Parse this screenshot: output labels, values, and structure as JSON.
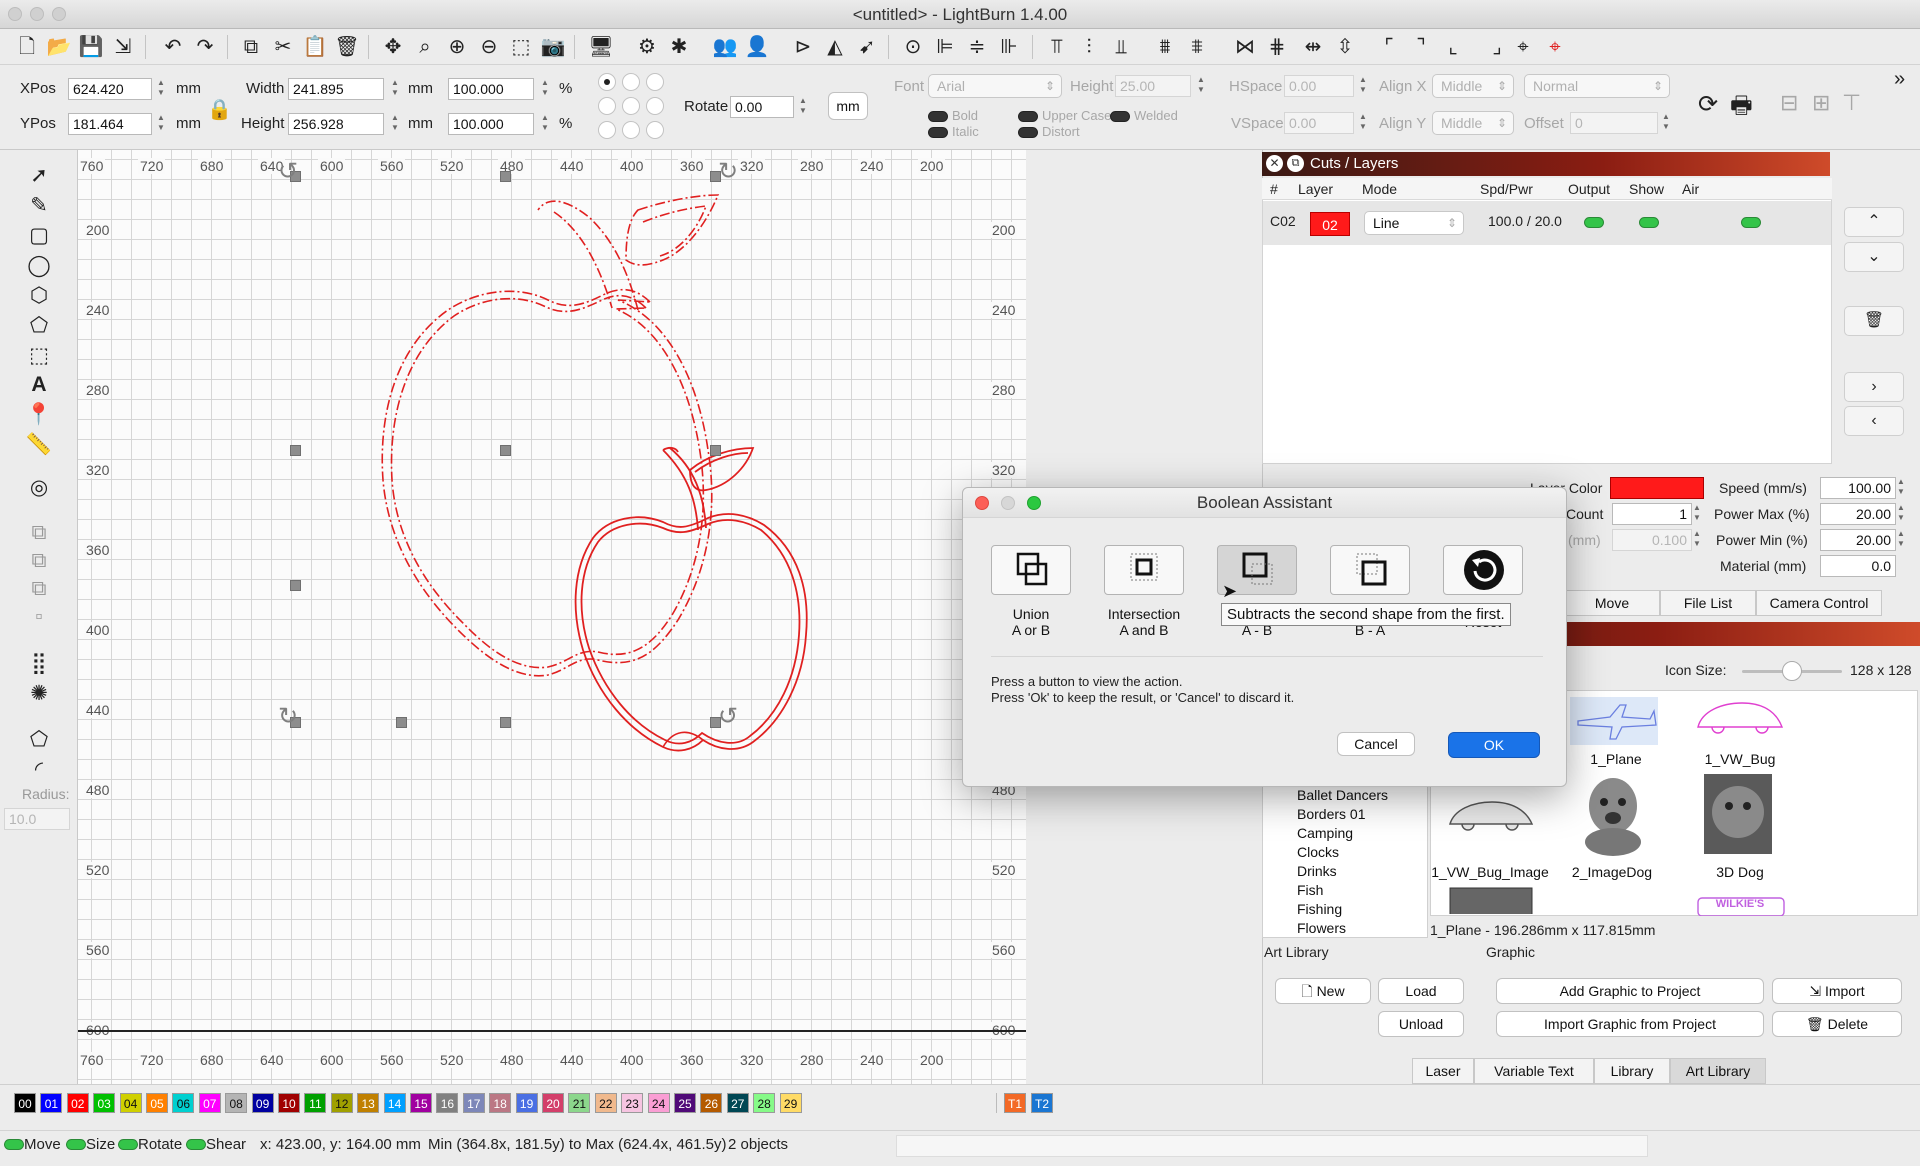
{
  "window": {
    "title": "<untitled> - LightBurn 1.4.00"
  },
  "toolbar2": {
    "xpos_label": "XPos",
    "xpos_value": "624.420",
    "ypos_label": "YPos",
    "ypos_value": "181.464",
    "width_label": "Width",
    "width_value": "241.895",
    "height_label": "Height",
    "height_value": "256.928",
    "scale_w": "100.000",
    "scale_h": "100.000",
    "unit_mm": "mm",
    "pct": "%",
    "rotate_label": "Rotate",
    "rotate_value": "0.00",
    "mm_button": "mm",
    "font_label": "Font",
    "font_value": "Arial",
    "font_height_label": "Height",
    "font_height_value": "25.00",
    "hspace_label": "HSpace",
    "hspace_value": "0.00",
    "vspace_label": "VSpace",
    "vspace_value": "0.00",
    "alignx_label": "Align X",
    "alignx_value": "Middle",
    "aligny_label": "Align Y",
    "aligny_value": "Middle",
    "normal_value": "Normal",
    "offset_label": "Offset",
    "offset_value": "0",
    "bold": "Bold",
    "italic": "Italic",
    "uppercase": "Upper Case",
    "distort": "Distort",
    "welded": "Welded"
  },
  "ruler": {
    "top": [
      "760",
      "720",
      "680",
      "640",
      "600",
      "560",
      "520",
      "480",
      "440",
      "400",
      "360",
      "320",
      "280",
      "240",
      "200"
    ],
    "left": [
      "200",
      "240",
      "280",
      "320",
      "360",
      "400",
      "440",
      "480",
      "520",
      "560",
      "600"
    ],
    "bottom": [
      "760",
      "720",
      "680",
      "640",
      "600",
      "560",
      "520",
      "480",
      "440",
      "400",
      "360",
      "320",
      "280",
      "240",
      "200"
    ]
  },
  "cuts": {
    "panel_title": "Cuts / Layers",
    "headers": [
      "#",
      "Layer",
      "Mode",
      "Spd/Pwr",
      "Output",
      "Show",
      "Air"
    ],
    "row": {
      "num": "C02",
      "layer": "02",
      "mode": "Line",
      "spdpwr": "100.0 / 20.0"
    },
    "layer_color_label": "Layer Color",
    "count_label": "Count",
    "count_value": "1",
    "interval_label": "(mm)",
    "interval_value": "0.100",
    "speed_label": "Speed (mm/s)",
    "speed_value": "100.00",
    "powermax_label": "Power Max (%)",
    "powermax_value": "20.00",
    "powermin_label": "Power Min (%)",
    "powermin_value": "20.00",
    "material_label": "Material (mm)",
    "material_value": "0.0",
    "layer_color": "#ff1a1a"
  },
  "tabs_top": [
    "Move",
    "File List",
    "Camera Control"
  ],
  "art": {
    "icon_size_label": "Icon Size:",
    "icon_size_value": "128 x 128",
    "categories": [
      "Ballet Dancers",
      "Borders 01",
      "Camping",
      "Clocks",
      "Drinks",
      "Fish",
      "Fishing",
      "Flowers"
    ],
    "thumbs": [
      "1_Plane",
      "1_VW_Bug",
      "1_VW_Bug_Image",
      "2_ImageDog",
      "3D Dog"
    ],
    "status": "1_Plane - 196.286mm x 117.815mm",
    "art_library_label": "Art Library",
    "graphic_label": "Graphic",
    "new": "New",
    "load": "Load",
    "unload": "Unload",
    "add_graphic": "Add Graphic to Project",
    "import_graphic": "Import Graphic from Project",
    "import": "Import",
    "delete": "Delete"
  },
  "tabs_bottom": [
    "Laser",
    "Variable Text",
    "Library",
    "Art Library"
  ],
  "left": {
    "radius_label": "Radius:",
    "radius_value": "10.0"
  },
  "palette": [
    "00",
    "01",
    "02",
    "03",
    "04",
    "05",
    "06",
    "07",
    "08",
    "09",
    "10",
    "11",
    "12",
    "13",
    "14",
    "15",
    "16",
    "17",
    "18",
    "19",
    "20",
    "21",
    "22",
    "23",
    "24",
    "25",
    "26",
    "27",
    "28",
    "29",
    "T1",
    "T2"
  ],
  "palette_colors": [
    "#000000",
    "#0000ff",
    "#ff0000",
    "#00c000",
    "#d0d000",
    "#ff8000",
    "#00d0d0",
    "#ff00ff",
    "#b4b4b4",
    "#0000a0",
    "#a00000",
    "#00a000",
    "#a0a000",
    "#c08000",
    "#00a0ff",
    "#a000a0",
    "#808080",
    "#7d87b9",
    "#bb7784",
    "#4a6fe3",
    "#d33f6a",
    "#8cd78c",
    "#f0b98d",
    "#f6c4e1",
    "#fa9ed4",
    "#500a78",
    "#b45a00",
    "#004754",
    "#86fa88",
    "#ffdb66",
    "#f36926",
    "#1a76d2"
  ],
  "status": {
    "move": "Move",
    "size": "Size",
    "rotate": "Rotate",
    "shear": "Shear",
    "coords": "x: 423.00, y: 164.00 mm",
    "bounds": "Min (364.8x, 181.5y) to Max (624.4x, 461.5y)",
    "objects": "2 objects"
  },
  "dialog": {
    "title": "Boolean Assistant",
    "union_l1": "Union",
    "union_l2": "A or B",
    "intersection_l1": "Intersection",
    "intersection_l2": "A and B",
    "subtract_l2": "A - B",
    "subtract_rev_l2": "B - A",
    "reset": "Reset",
    "tooltip": "Subtracts the second shape from the first.",
    "help1": "Press a button to view the action.",
    "help2": "Press 'Ok' to keep the result, or 'Cancel' to discard it.",
    "cancel": "Cancel",
    "ok": "OK"
  }
}
